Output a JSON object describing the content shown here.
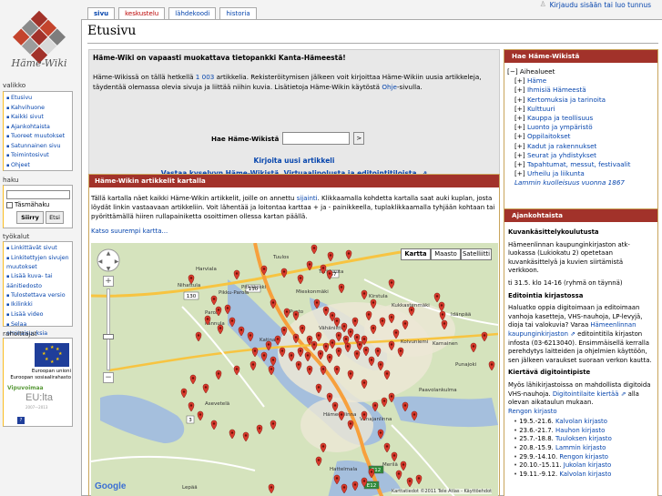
{
  "user_bar": {
    "login": "Kirjaudu sisään tai luo tunnus"
  },
  "logo": {
    "text": "Häme-Wiki"
  },
  "tabs": [
    "sivu",
    "keskustelu",
    "lähdekoodi",
    "historia"
  ],
  "page": {
    "title": "Etusivu"
  },
  "welcome": {
    "heading": "Häme-Wiki on vapaasti muokattava tietopankki Kanta-Hämeestä!",
    "p1_a": "Häme-Wikissä on tällä hetkellä ",
    "article_count": "1 003",
    "p1_b": " artikkelia. Rekisteröitymisen jälkeen voit kirjoittaa Häme-Wikiin uusia artikkeleja, täydentää olemassa olevia sivuja ja liittää niihin kuvia. Lisätietoja Häme-Wikin käytöstä ",
    "help_link": "Ohje",
    "p1_c": "-sivulla.",
    "search_label": "Hae Häme-Wikistä",
    "search_button": ">",
    "link_new_article": "Kirjoita uusi artikkeli",
    "link_survey": "Vastaa kyselyyn Häme-Wikistä, Virtuaalipolusta ja editointitiloista. ⇗"
  },
  "map_section": {
    "header": "Häme-Wikin artikkelit kartalla",
    "intro_a": "Tällä kartalla näet kaikki Häme-Wikin artikkelit, joille on annettu ",
    "intro_link": "sijainti",
    "intro_b": ". Klikkaamalla kohdetta kartalla saat auki kuplan, josta löydät linkin vastaavaan artikkeliin. Voit lähentää ja loitontaa karttaa + ja - painikkeella, tuplaklikkaamalla tyhjään kohtaan tai pyörittämällä hiiren rullapainiketta osoittimen ollessa kartan päällä.",
    "more_link": "Katso suurempi kartta...",
    "map_types": [
      "Kartta",
      "Maasto",
      "Satelliitti"
    ],
    "place_labels": [
      "Tuulos",
      "Turkhauta",
      "Harviala",
      "Nihattula",
      "Pitkäkoski",
      "Pikku-Parola",
      "Parola",
      "Pannula",
      "Katinala",
      "Mieskonmäki",
      "Kirstula",
      "Pusto",
      "Kukkastenmäki",
      "Koivuniemi",
      "Vähäniittu",
      "Asevetelä",
      "Hattelmala",
      "Vanajanlinna",
      "Paavolankulma",
      "Punajoki",
      "Hämeenlinna",
      "Idänpää",
      "Karnainen",
      "Merilä",
      "Lepää"
    ],
    "road_labels": [
      "130",
      "130",
      "57",
      "3",
      "E12",
      "E12"
    ],
    "copyright": "Karttatiedot ©2011 Tele Atlas - Käyttöehdot",
    "google": "Google"
  },
  "hame_wikista": {
    "header": "Hae Häme-Wikistä",
    "root": "[−] Aihealueet",
    "items": [
      "Häme",
      "Ihmisiä Hämeestä",
      "Kertomuksia ja tarinoita",
      "Kulttuuri",
      "Kauppa ja teollisuus",
      "Luonto ja ympäristö",
      "Oppilaitokset",
      "Kadut ja rakennukset",
      "Seurat ja yhdistykset",
      "Tapahtumat, messut, festivaalit",
      "Urheilu ja liikunta"
    ],
    "toggle": "[+]",
    "note": "Lammin kuolleisuus vuonna 1867"
  },
  "ajankohtaista": {
    "header": "Ajankohtaista",
    "h1": "Kuvankäsittelykoulutusta",
    "p1": "Hämeenlinnan kaupunginkirjaston atk-luokassa (Lukiokatu 2) opetetaan kuvankäsittelyä ja kuvien siirtämistä verkkoon.",
    "p2": "ti 31.5. klo 14-16 (ryhmä on täynnä)",
    "h2": "Editointia kirjastossa",
    "p3_a": "Haluatko oppia digitoimaan ja editoimaan vanhoja kasetteja, VHS-nauhoja, LP-levyjä, dioja tai valokuvia? Varaa ",
    "p3_link": "Hämeenlinnan kaupunginkirjaston ⇗",
    "p3_b": " editointitila kirjaston infosta (03-6213040). Ensimmäisellä kerralla perehdytys laitteiden ja ohjelmien käyttöön, sen jälkeen varaukset suoraan verkon kautta.",
    "h3": "Kiertävä digitointipiste",
    "p4_a": "Myös lähikirjastoissa on mahdollista digitoida VHS-nauhoja. ",
    "p4_link": "Digitointilaite kiertää ⇗",
    "p4_b": " alla olevan aikataulun mukaan.",
    "p5": "Rengon kirjasto",
    "schedule": [
      {
        "date": "19.5.-21.6. ",
        "lib": "Kalvolan kirjasto"
      },
      {
        "date": "23.6.-21.7. ",
        "lib": "Hauhon kirjasto"
      },
      {
        "date": "25.7.-18.8. ",
        "lib": "Tuuloksen kirjasto"
      },
      {
        "date": "20.8.-15.9. ",
        "lib": "Lammin kirjasto"
      },
      {
        "date": "29.9.-14.10. ",
        "lib": "Rengon kirjasto"
      },
      {
        "date": "20.10.-15.11. ",
        "lib": "Jukolan kirjasto"
      },
      {
        "date": "19.11.-9.12. ",
        "lib": "Kalvolan kirjasto"
      }
    ]
  },
  "sidebar": {
    "nav_title": "valikko",
    "nav_items": [
      "Etusivu",
      "Kahvihuone",
      "Kaikki sivut",
      "Ajankohtaista",
      "Tuoreet muutokset",
      "Satunnainen sivu",
      "Toimintosivut",
      "Ohjeet"
    ],
    "search_title": "haku",
    "search_checkbox": "Täsmähaku",
    "go_button": "Siirry",
    "search_button": "Etsi",
    "tools_title": "työkalut",
    "tools_items": [
      "Linkittävät sivut",
      "Linkitettyjen sivujen muutokset",
      "Lisää kuva- tai äänitiedosto",
      "Tulostettava versio",
      "Ikilinkki",
      "Lisää video",
      "Selaa ominaisuuksia"
    ],
    "funders_title": "rahoittajat",
    "eu_text_1": "Euroopan unioni",
    "eu_text_2": "Euroopan sosiaalirahasto",
    "vipu_1": "Vipuvoimaa",
    "vipu_2": "EU:lta",
    "vipu_3": "2007—2013"
  },
  "colors": {
    "header_red": "#a2322a",
    "link_blue": "#0645ad",
    "marker_red": "#d83a2c"
  }
}
